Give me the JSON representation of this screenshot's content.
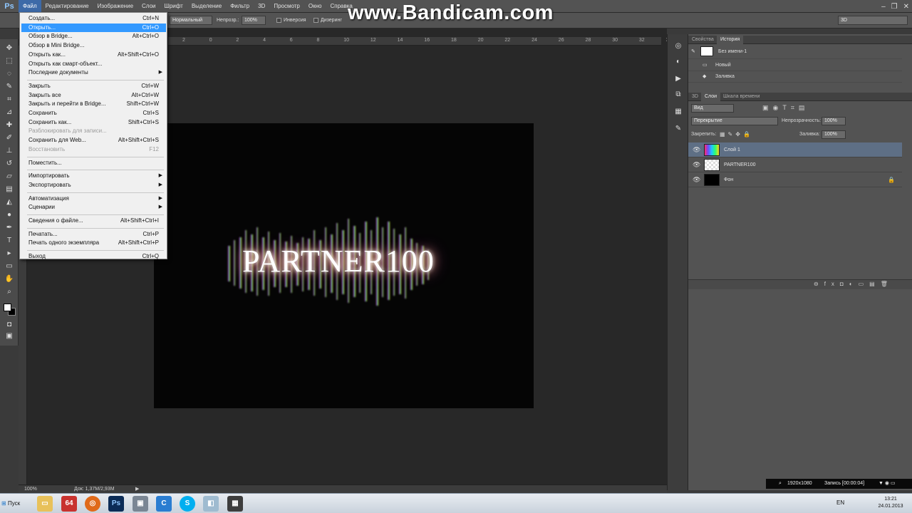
{
  "app": {
    "logo": "Ps"
  },
  "watermark": "www.Bandicam.com",
  "menubar": [
    {
      "label": "Файл"
    },
    {
      "label": "Редактирование"
    },
    {
      "label": "Изображение"
    },
    {
      "label": "Слои"
    },
    {
      "label": "Шрифт"
    },
    {
      "label": "Выделение"
    },
    {
      "label": "Фильтр"
    },
    {
      "label": "3D"
    },
    {
      "label": "Просмотр"
    },
    {
      "label": "Окно"
    },
    {
      "label": "Справка"
    }
  ],
  "window_controls": {
    "minimize": "–",
    "restore": "❐",
    "close": "✕"
  },
  "options_bar": {
    "mode_value": "Нормальный",
    "opacity_label": "Непрозр.:",
    "opacity_value": "100%",
    "inverse_label": "Инверсия",
    "dither_label": "Дизеринг",
    "workspace_value": "3D"
  },
  "ruler": {
    "top_ticks": [
      "2",
      "0",
      "2",
      "4",
      "6",
      "8",
      "10",
      "12",
      "14",
      "16",
      "18",
      "20",
      "22",
      "24",
      "26",
      "28",
      "30",
      "32",
      "34",
      "36"
    ]
  },
  "canvas": {
    "text": "PARTNER100"
  },
  "file_menu": {
    "items": [
      {
        "label": "Создать...",
        "shortcut": "Ctrl+N"
      },
      {
        "label": "Открыть...",
        "shortcut": "Ctrl+O",
        "highlighted": true
      },
      {
        "label": "Обзор в Bridge...",
        "shortcut": "Alt+Ctrl+O"
      },
      {
        "label": "Обзор в Mini Bridge...",
        "shortcut": ""
      },
      {
        "label": "Открыть как...",
        "shortcut": "Alt+Shift+Ctrl+O"
      },
      {
        "label": "Открыть как смарт-объект...",
        "shortcut": ""
      },
      {
        "label": "Последние документы",
        "shortcut": "",
        "submenu": true
      },
      {
        "separator": true
      },
      {
        "label": "Закрыть",
        "shortcut": "Ctrl+W"
      },
      {
        "label": "Закрыть все",
        "shortcut": "Alt+Ctrl+W"
      },
      {
        "label": "Закрыть и перейти в Bridge...",
        "shortcut": "Shift+Ctrl+W"
      },
      {
        "label": "Сохранить",
        "shortcut": "Ctrl+S"
      },
      {
        "label": "Сохранить как...",
        "shortcut": "Shift+Ctrl+S"
      },
      {
        "label": "Разблокировать для записи...",
        "shortcut": "",
        "disabled": true
      },
      {
        "label": "Сохранить для Web...",
        "shortcut": "Alt+Shift+Ctrl+S"
      },
      {
        "label": "Восстановить",
        "shortcut": "F12",
        "disabled": true
      },
      {
        "separator": true
      },
      {
        "label": "Поместить...",
        "shortcut": ""
      },
      {
        "separator": true
      },
      {
        "label": "Импортировать",
        "shortcut": "",
        "submenu": true
      },
      {
        "label": "Экспортировать",
        "shortcut": "",
        "submenu": true
      },
      {
        "separator": true
      },
      {
        "label": "Автоматизация",
        "shortcut": "",
        "submenu": true
      },
      {
        "label": "Сценарии",
        "shortcut": "",
        "submenu": true
      },
      {
        "separator": true
      },
      {
        "label": "Сведения о файле...",
        "shortcut": "Alt+Shift+Ctrl+I"
      },
      {
        "separator": true
      },
      {
        "label": "Печатать...",
        "shortcut": "Ctrl+P"
      },
      {
        "label": "Печать одного экземпляра",
        "shortcut": "Alt+Shift+Ctrl+P"
      },
      {
        "separator": true
      },
      {
        "label": "Выход",
        "shortcut": "Ctrl+Q"
      }
    ]
  },
  "history_panel": {
    "tabs": [
      "Свойства",
      "История"
    ],
    "snapshot": "Без имени-1",
    "states": [
      "Новый",
      "Заливка"
    ]
  },
  "layers_panel": {
    "tabs": [
      "3D",
      "Слои",
      "Шкала времени"
    ],
    "filter_value": "Вид",
    "blend_value": "Перекрытие",
    "opacity_label": "Непрозрачность:",
    "opacity_value": "100%",
    "lock_label": "Закрепить:",
    "fill_label": "Заливка:",
    "fill_value": "100%",
    "layers": [
      {
        "name": "Слой 1",
        "selected": true,
        "thumb": "rainbow"
      },
      {
        "name": "PARTNER100",
        "selected": false,
        "thumb": "transparent"
      },
      {
        "name": "Фон",
        "selected": false,
        "thumb": "black",
        "locked": true
      }
    ]
  },
  "status_bar": {
    "zoom": "100%",
    "doc": "Док: 1,37M/2,93M"
  },
  "recording": {
    "resolution": "1920x1080",
    "label": "Запись [00:00:04]"
  },
  "taskbar": {
    "start_label": "Пуск",
    "language": "EN",
    "time": "13:21",
    "date": "24.01.2013"
  }
}
